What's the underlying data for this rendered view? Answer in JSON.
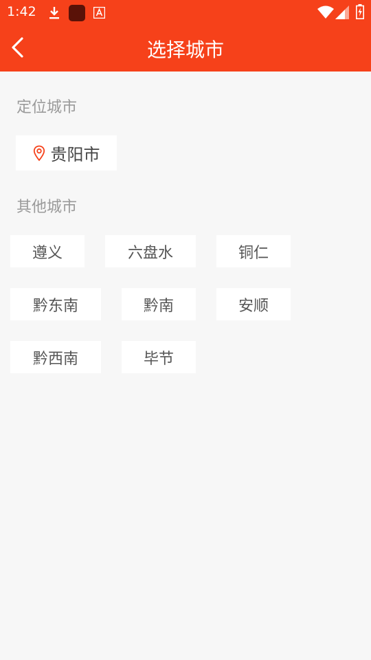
{
  "status_bar": {
    "time": "1:42"
  },
  "header": {
    "title": "选择城市"
  },
  "located": {
    "label": "定位城市",
    "city": "贵阳市"
  },
  "others": {
    "label": "其他城市",
    "cities": [
      "遵义",
      "六盘水",
      "铜仁",
      "黔东南",
      "黔南",
      "安顺",
      "黔西南",
      "毕节"
    ]
  },
  "colors": {
    "accent": "#f6411a",
    "background": "#f7f7f7",
    "chip": "#ffffff",
    "muted_text": "#9a9a9a"
  }
}
